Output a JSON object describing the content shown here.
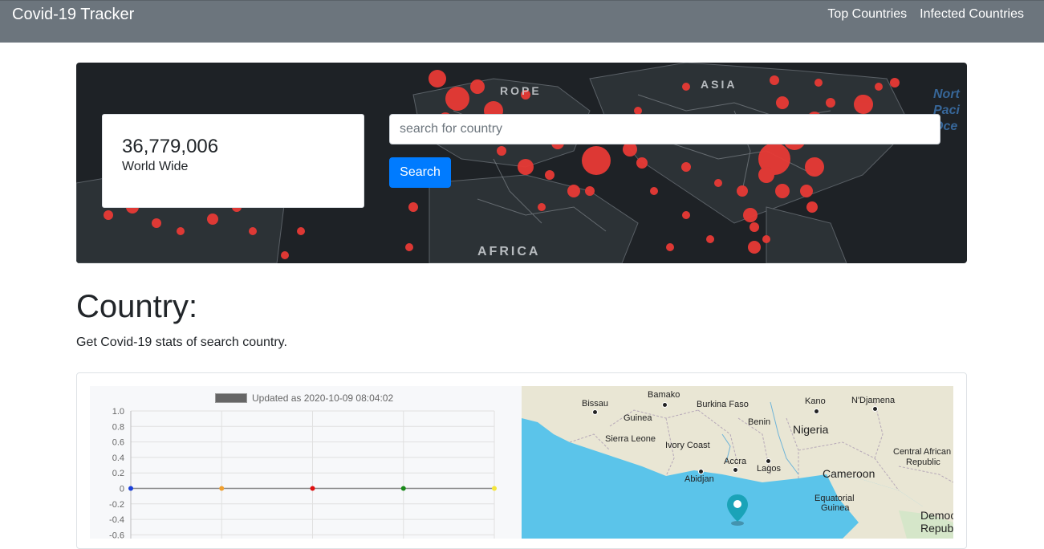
{
  "navbar": {
    "brand": "Covid-19 Tracker",
    "links": [
      "Top Countries",
      "Infected Countries"
    ]
  },
  "hero": {
    "world_total": "36,779,006",
    "world_label": "World Wide",
    "map_labels": [
      "ROPE",
      "ASIA",
      "AFRICA",
      "Nort",
      "Paci",
      "Oce"
    ],
    "search": {
      "placeholder": "search for country",
      "button_label": "Search"
    }
  },
  "section": {
    "title": "Country:",
    "subtitle": "Get Covid-19 stats of search country."
  },
  "chart_data": {
    "type": "line",
    "legend": "Updated as 2020-10-09 08:04:02",
    "x": [
      0,
      1,
      2,
      3,
      4
    ],
    "series": [
      {
        "values": [
          0,
          0,
          0,
          0,
          0
        ]
      }
    ],
    "point_colors": [
      "#1a3fd9",
      "#f0a030",
      "#e01010",
      "#1a8a1a",
      "#f5e63a"
    ],
    "ylim": [
      -0.6,
      1.0
    ],
    "yticks": [
      "1.0",
      "0.8",
      "0.6",
      "0.4",
      "0.2",
      "0",
      "-0.2",
      "-0.4",
      "-0.6"
    ],
    "grid": true
  },
  "map": {
    "labels": [
      {
        "text": "Bamako",
        "size": "small"
      },
      {
        "text": "Bissau",
        "size": "small"
      },
      {
        "text": "Guinea",
        "size": "small"
      },
      {
        "text": "Burkina Faso",
        "size": "small"
      },
      {
        "text": "Kano",
        "size": "small"
      },
      {
        "text": "N'Djamena",
        "size": "small"
      },
      {
        "text": "Benin",
        "size": "small"
      },
      {
        "text": "Nigeria",
        "size": "big"
      },
      {
        "text": "Sierra Leone",
        "size": "small"
      },
      {
        "text": "Ivory Coast",
        "size": "small"
      },
      {
        "text": "Accra",
        "size": "small"
      },
      {
        "text": "Lagos",
        "size": "small"
      },
      {
        "text": "Abidjan",
        "size": "small"
      },
      {
        "text": "Cameroon",
        "size": "big"
      },
      {
        "text": "Central African",
        "size": "small"
      },
      {
        "text": "Republic",
        "size": "small"
      },
      {
        "text": "Equatorial",
        "size": "small"
      },
      {
        "text": "Guinea",
        "size": "small"
      },
      {
        "text": "Democ",
        "size": "big"
      },
      {
        "text": "Repub",
        "size": "big"
      }
    ],
    "colors": {
      "ocean": "#5bc4ea",
      "land": "#e9e6d4",
      "marker": "#1aa3b8"
    }
  }
}
